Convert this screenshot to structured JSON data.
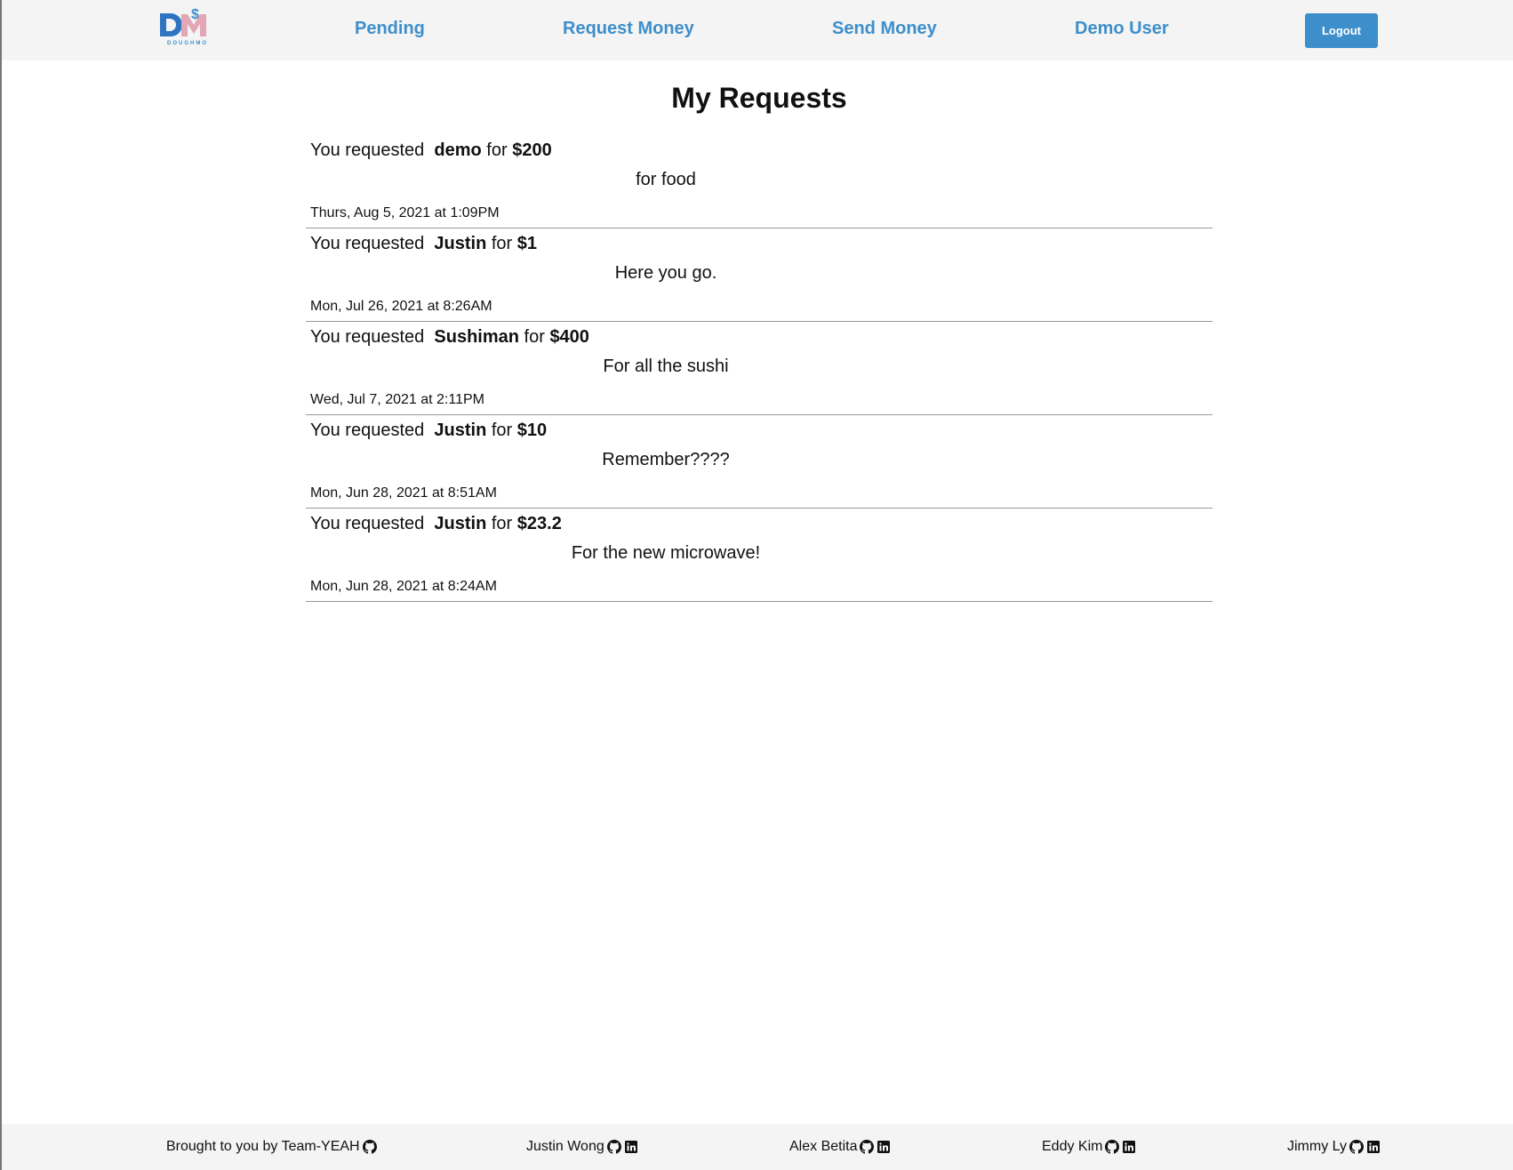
{
  "header": {
    "logo_text": "DOUGHMO",
    "nav": [
      {
        "label": "Pending"
      },
      {
        "label": "Request Money"
      },
      {
        "label": "Send Money"
      },
      {
        "label": "Demo User"
      }
    ],
    "logout_label": "Logout"
  },
  "main": {
    "title": "My Requests",
    "requests": [
      {
        "prefix": "You requested",
        "name": "demo",
        "for": "for",
        "amount": "$200",
        "note": "for food",
        "date": "Thurs, Aug 5, 2021 at 1:09PM"
      },
      {
        "prefix": "You requested",
        "name": "Justin",
        "for": "for",
        "amount": "$1",
        "note": "Here you go.",
        "date": "Mon, Jul 26, 2021 at 8:26AM"
      },
      {
        "prefix": "You requested",
        "name": "Sushiman",
        "for": "for",
        "amount": "$400",
        "note": "For all the sushi",
        "date": "Wed, Jul 7, 2021 at 2:11PM"
      },
      {
        "prefix": "You requested",
        "name": "Justin",
        "for": "for",
        "amount": "$10",
        "note": "Remember????",
        "date": "Mon, Jun 28, 2021 at 8:51AM"
      },
      {
        "prefix": "You requested",
        "name": "Justin",
        "for": "for",
        "amount": "$23.2",
        "note": "For the new microwave!",
        "date": "Mon, Jun 28, 2021 at 8:24AM"
      }
    ]
  },
  "footer": {
    "credits": [
      {
        "label": "Brought to you by Team-YEAH",
        "icons": [
          "github-icon"
        ]
      },
      {
        "label": "Justin Wong",
        "icons": [
          "github-icon",
          "linkedin-icon"
        ]
      },
      {
        "label": "Alex Betita",
        "icons": [
          "github-icon",
          "linkedin-icon"
        ]
      },
      {
        "label": "Eddy Kim",
        "icons": [
          "github-icon",
          "linkedin-icon"
        ]
      },
      {
        "label": "Jimmy Ly",
        "icons": [
          "github-icon",
          "linkedin-icon"
        ]
      }
    ]
  },
  "colors": {
    "accent": "#3d8fcb",
    "header_bg": "#f4f4f4",
    "logo_dark": "#2f74c0",
    "logo_pink": "#e2a6b4"
  }
}
